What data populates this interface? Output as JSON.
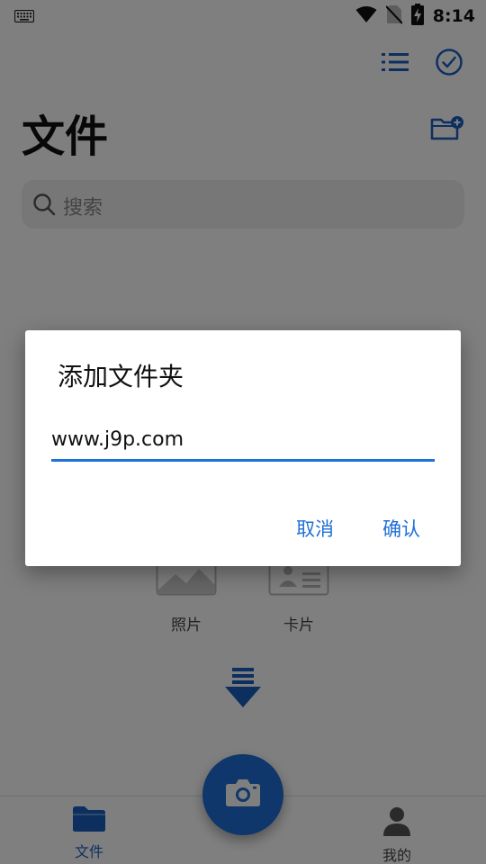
{
  "status_bar": {
    "time": "8:14",
    "icons": [
      "keyboard-icon",
      "wifi-icon",
      "no-sim-icon",
      "battery-charging-icon"
    ]
  },
  "header": {
    "title": "文件",
    "actions": [
      "list-icon",
      "check-circle-icon",
      "add-folder-icon"
    ]
  },
  "search": {
    "placeholder": "搜索"
  },
  "categories": [
    {
      "label": "照片",
      "icon": "image-icon"
    },
    {
      "label": "卡片",
      "icon": "id-card-icon"
    }
  ],
  "bottom_nav": {
    "items": [
      {
        "label": "文件",
        "icon": "folder-icon",
        "active": true
      },
      {
        "label": "我的",
        "icon": "person-icon",
        "active": false
      }
    ],
    "fab_icon": "camera-icon"
  },
  "dialog": {
    "title": "添加文件夹",
    "input_value": "www.j9p.com",
    "cancel_label": "取消",
    "confirm_label": "确认"
  },
  "colors": {
    "accent": "#1f6fd6",
    "icon_blue": "#1a5fbf",
    "scrim": "rgba(0,0,0,0.5)"
  }
}
